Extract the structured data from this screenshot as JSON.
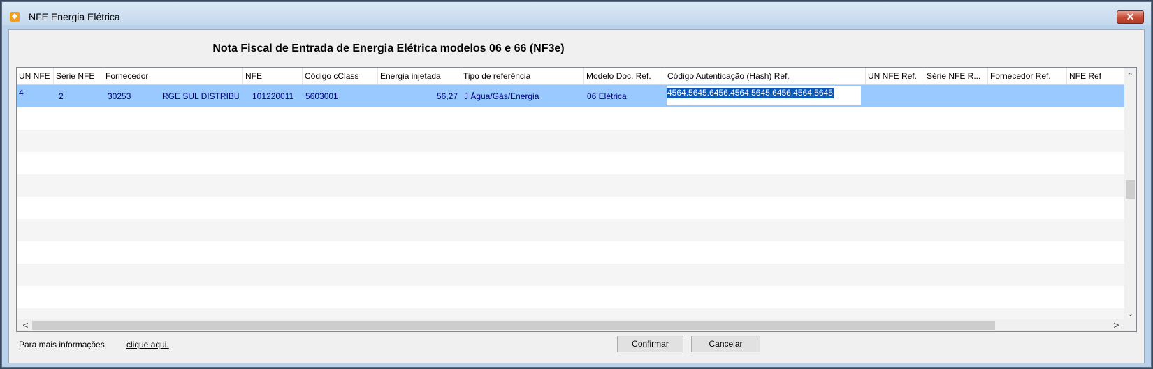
{
  "window": {
    "title": "NFE Energia Elétrica",
    "app_icon": "app-logo-icon",
    "close_icon": "close-icon",
    "close_glyph": "✕"
  },
  "heading": "Nota Fiscal de Entrada de Energia Elétrica modelos 06 e 66 (NF3e)",
  "grid": {
    "columns": [
      "UN NFE",
      "Série NFE",
      "Fornecedor",
      "NFE",
      "Código cClass",
      "Energia injetada",
      "Tipo de referência",
      "Modelo Doc. Ref.",
      "Código Autenticação (Hash) Ref.",
      "UN NFE Ref.",
      "Série NFE R...",
      "Fornecedor Ref.",
      "NFE Ref"
    ],
    "rows": [
      {
        "un_nfe": "4",
        "serie_nfe": "2",
        "fornecedor_codigo": "30253",
        "fornecedor_nome": "RGE SUL DISTRIBU",
        "nfe": "101220011",
        "codigo_cclass": "5603001",
        "energia_injetada": "56,27",
        "tipo_referencia": "J Água/Gás/Energia",
        "modelo_doc_ref": "06 Elétrica",
        "hash_ref": "4564.5645.6456.4564.5645.6456.4564.5645"
      }
    ]
  },
  "scroll": {
    "up": "⌃",
    "down": "⌄",
    "left": "<",
    "right": ">"
  },
  "footer": {
    "info_text": "Para mais informações,",
    "info_link": "clique aqui.",
    "confirm_label": "Confirmar",
    "cancel_label": "Cancelar"
  },
  "colors": {
    "selection": "#99c9ff",
    "cell_text": "#000080",
    "hash_highlight": "#0a58b8"
  }
}
